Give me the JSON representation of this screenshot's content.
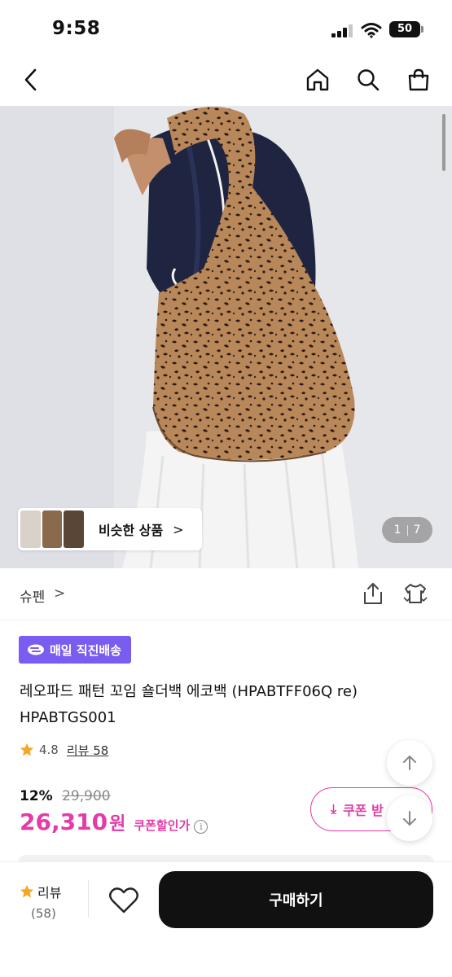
{
  "status_bar": {
    "time": "9:58",
    "battery": "50"
  },
  "gallery": {
    "similar_label": "비슷한 상품",
    "current_page": "1",
    "total_pages": "7"
  },
  "brand": {
    "name": "슈펜"
  },
  "badge": {
    "label": "매일 직진배송"
  },
  "product": {
    "title_line1": "레오파드 패턴 꼬임 숄더백 에코백 (HPABTFF06Q re)",
    "title_line2": "HPABTGS001",
    "rating": "4.8",
    "review_label": "리뷰 58",
    "discount_rate": "12%",
    "original_price": "29,900",
    "sale_price": "26,310",
    "currency": "원",
    "coupon_note": "쿠폰할인가",
    "coupon_button": "쿠폰 받"
  },
  "bottom_bar": {
    "review_label": "리뷰",
    "review_count": "(58)",
    "buy_label": "구매하기"
  },
  "colors": {
    "accent_pink": "#e43ba8",
    "badge_purple": "#7b5cf0",
    "star": "#f5a623",
    "buy_button": "#111111"
  },
  "icons": [
    "back-icon",
    "home-icon",
    "search-icon",
    "cart-icon",
    "share-icon",
    "shirt-icon",
    "star-icon",
    "heart-icon",
    "arrow-up-icon",
    "arrow-down-icon",
    "info-icon",
    "download-icon",
    "delivery-icon"
  ]
}
